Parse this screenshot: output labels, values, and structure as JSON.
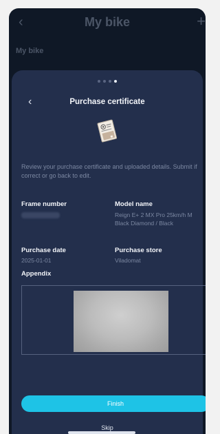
{
  "background_screen": {
    "title": "My bike",
    "subtitle": "My bike"
  },
  "sheet": {
    "pager": {
      "count": 4,
      "active_index": 3
    },
    "title": "Purchase certificate",
    "description": "Review your purchase certificate and uploaded details. Submit if correct or go back to edit.",
    "fields": {
      "frame_number_label": "Frame number",
      "model_name_label": "Model name",
      "model_name_value": "Reign E+ 2 MX Pro 25km/h M Black Diamond / Black",
      "purchase_date_label": "Purchase date",
      "purchase_date_value": "2025-01-01",
      "purchase_store_label": "Purchase store",
      "purchase_store_value": "Viladomat"
    },
    "appendix_label": "Appendix",
    "finish_label": "Finish",
    "skip_label": "Skip"
  },
  "icons": {
    "back": "chevron-left-icon",
    "add": "plus-icon",
    "certificate": "certificate-icon"
  },
  "colors": {
    "accent": "#1ec3e6",
    "sheet_background": "#232f4c",
    "app_background": "#0f1826"
  }
}
